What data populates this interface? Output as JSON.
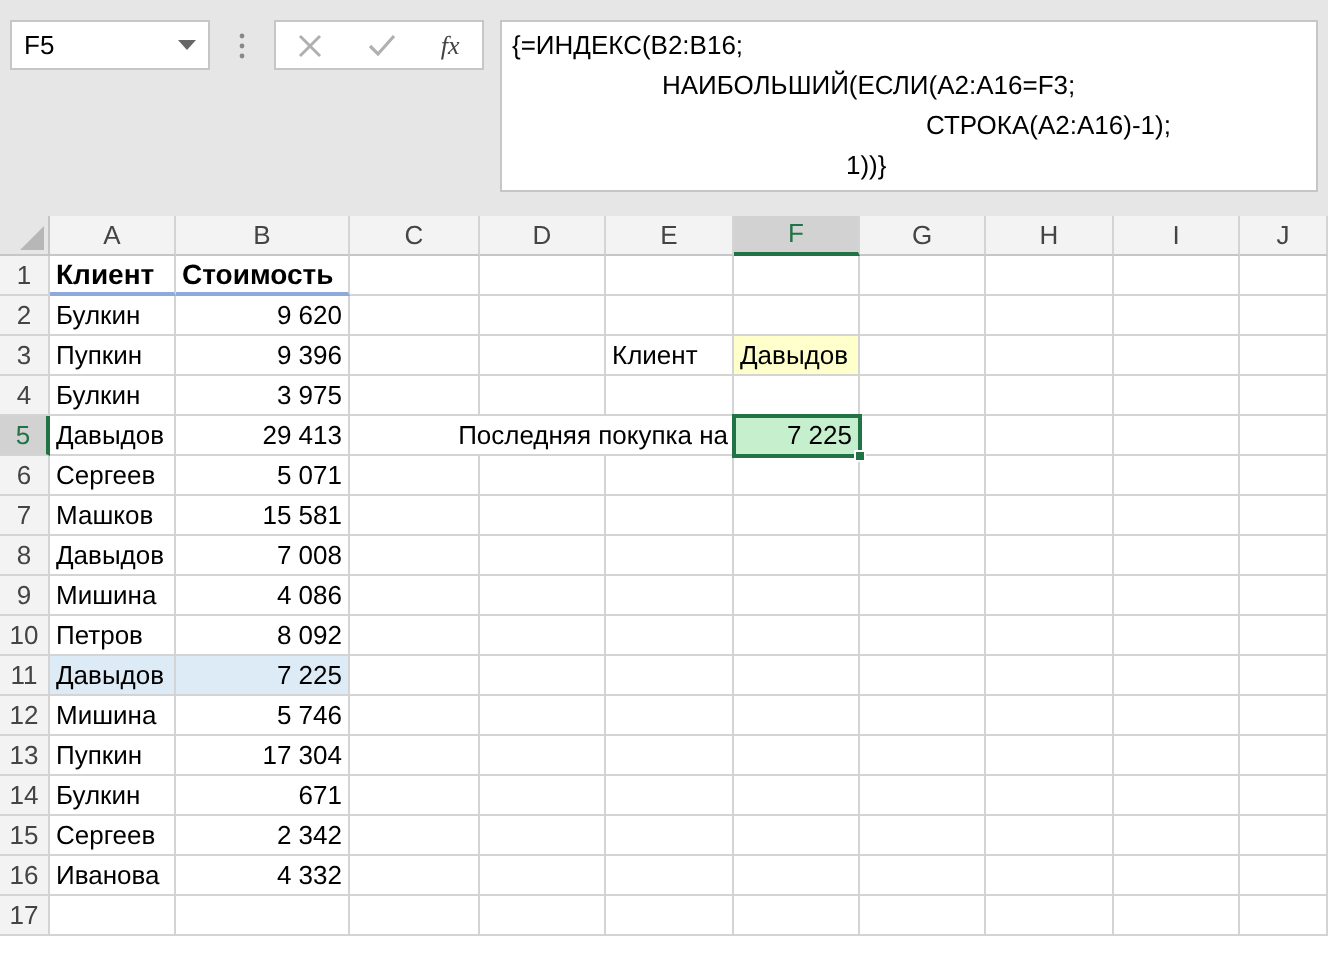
{
  "name_box": "F5",
  "formula_bar": {
    "function_label": "fx",
    "lines": [
      "{=ИНДЕКС(B2:B16;",
      "НАИБОЛЬШИЙ(ЕСЛИ(A2:A16=F3;",
      "СТРОКА(A2:A16)-1);",
      "1))}"
    ]
  },
  "columns": [
    {
      "label": "A",
      "selected": false
    },
    {
      "label": "B",
      "selected": false
    },
    {
      "label": "C",
      "selected": false
    },
    {
      "label": "D",
      "selected": false
    },
    {
      "label": "E",
      "selected": false
    },
    {
      "label": "F",
      "selected": true
    },
    {
      "label": "G",
      "selected": false
    },
    {
      "label": "H",
      "selected": false
    },
    {
      "label": "I",
      "selected": false
    },
    {
      "label": "J",
      "selected": false
    }
  ],
  "rows": [
    {
      "number": "1",
      "selected": false,
      "highlighted": false,
      "cells": [
        {
          "text": "Клиент",
          "kind": "heading"
        },
        {
          "text": "Стоимость",
          "kind": "heading"
        }
      ]
    },
    {
      "number": "2",
      "selected": false,
      "highlighted": false,
      "cells": [
        {
          "text": "Булкин",
          "kind": "text"
        },
        {
          "text": "9 620",
          "kind": "number"
        }
      ]
    },
    {
      "number": "3",
      "selected": false,
      "highlighted": false,
      "cells": [
        {
          "text": "Пупкин",
          "kind": "text"
        },
        {
          "text": "9 396",
          "kind": "number"
        },
        {},
        {},
        {
          "text": "Клиент",
          "kind": "text"
        },
        {
          "text": "Давыдов",
          "kind": "input"
        }
      ]
    },
    {
      "number": "4",
      "selected": false,
      "highlighted": false,
      "cells": [
        {
          "text": "Булкин",
          "kind": "text"
        },
        {
          "text": "3 975",
          "kind": "number"
        }
      ]
    },
    {
      "number": "5",
      "selected": true,
      "highlighted": false,
      "cells": [
        {
          "text": "Давыдов",
          "kind": "text"
        },
        {
          "text": "29 413",
          "kind": "number"
        },
        {},
        {},
        {
          "text": "Последняя покупка на",
          "kind": "label"
        },
        {
          "text": "7 225",
          "kind": "result"
        }
      ]
    },
    {
      "number": "6",
      "selected": false,
      "highlighted": false,
      "cells": [
        {
          "text": "Сергеев",
          "kind": "text"
        },
        {
          "text": "5 071",
          "kind": "number"
        }
      ]
    },
    {
      "number": "7",
      "selected": false,
      "highlighted": false,
      "cells": [
        {
          "text": "Машков",
          "kind": "text"
        },
        {
          "text": "15 581",
          "kind": "number"
        }
      ]
    },
    {
      "number": "8",
      "selected": false,
      "highlighted": false,
      "cells": [
        {
          "text": "Давыдов",
          "kind": "text"
        },
        {
          "text": "7 008",
          "kind": "number"
        }
      ]
    },
    {
      "number": "9",
      "selected": false,
      "highlighted": false,
      "cells": [
        {
          "text": "Мишина",
          "kind": "text"
        },
        {
          "text": "4 086",
          "kind": "number"
        }
      ]
    },
    {
      "number": "10",
      "selected": false,
      "highlighted": false,
      "cells": [
        {
          "text": "Петров",
          "kind": "text"
        },
        {
          "text": "8 092",
          "kind": "number"
        }
      ]
    },
    {
      "number": "11",
      "selected": false,
      "highlighted": true,
      "cells": [
        {
          "text": "Давыдов",
          "kind": "text"
        },
        {
          "text": "7 225",
          "kind": "number"
        }
      ]
    },
    {
      "number": "12",
      "selected": false,
      "highlighted": false,
      "cells": [
        {
          "text": "Мишина",
          "kind": "text"
        },
        {
          "text": "5 746",
          "kind": "number"
        }
      ]
    },
    {
      "number": "13",
      "selected": false,
      "highlighted": false,
      "cells": [
        {
          "text": "Пупкин",
          "kind": "text"
        },
        {
          "text": "17 304",
          "kind": "number"
        }
      ]
    },
    {
      "number": "14",
      "selected": false,
      "highlighted": false,
      "cells": [
        {
          "text": "Булкин",
          "kind": "text"
        },
        {
          "text": "671",
          "kind": "number"
        }
      ]
    },
    {
      "number": "15",
      "selected": false,
      "highlighted": false,
      "cells": [
        {
          "text": "Сергеев",
          "kind": "text"
        },
        {
          "text": "2 342",
          "kind": "number"
        }
      ]
    },
    {
      "number": "16",
      "selected": false,
      "highlighted": false,
      "cells": [
        {
          "text": "Иванова",
          "kind": "text"
        },
        {
          "text": "4 332",
          "kind": "number"
        }
      ]
    },
    {
      "number": "17",
      "selected": false,
      "highlighted": false
    }
  ]
}
